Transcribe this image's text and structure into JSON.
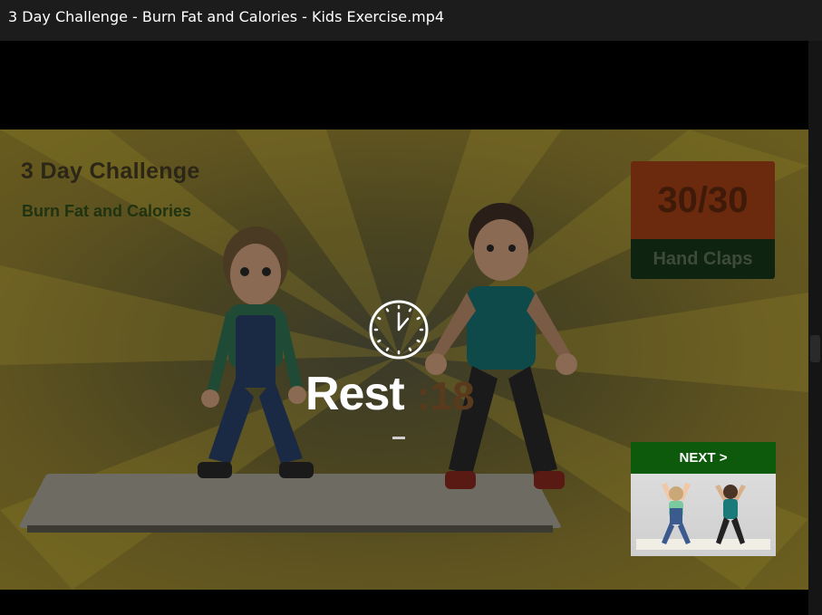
{
  "window": {
    "title": "3 Day Challenge - Burn Fat and Calories - Kids Exercise.mp4"
  },
  "video": {
    "title": "3 Day Challenge",
    "subtitle": "Burn Fat and Calories",
    "counter": {
      "count": "30/30",
      "exercise": "Hand Claps"
    },
    "overlay": {
      "icon": "clock-icon",
      "label": "Rest",
      "timer": ":18"
    },
    "next": {
      "label": "NEXT >"
    }
  },
  "colors": {
    "overlay_text": "#ffffff",
    "next_header": "#0d5a0d",
    "counter_top": "#6b2a0e",
    "counter_bottom": "#0f2410"
  }
}
